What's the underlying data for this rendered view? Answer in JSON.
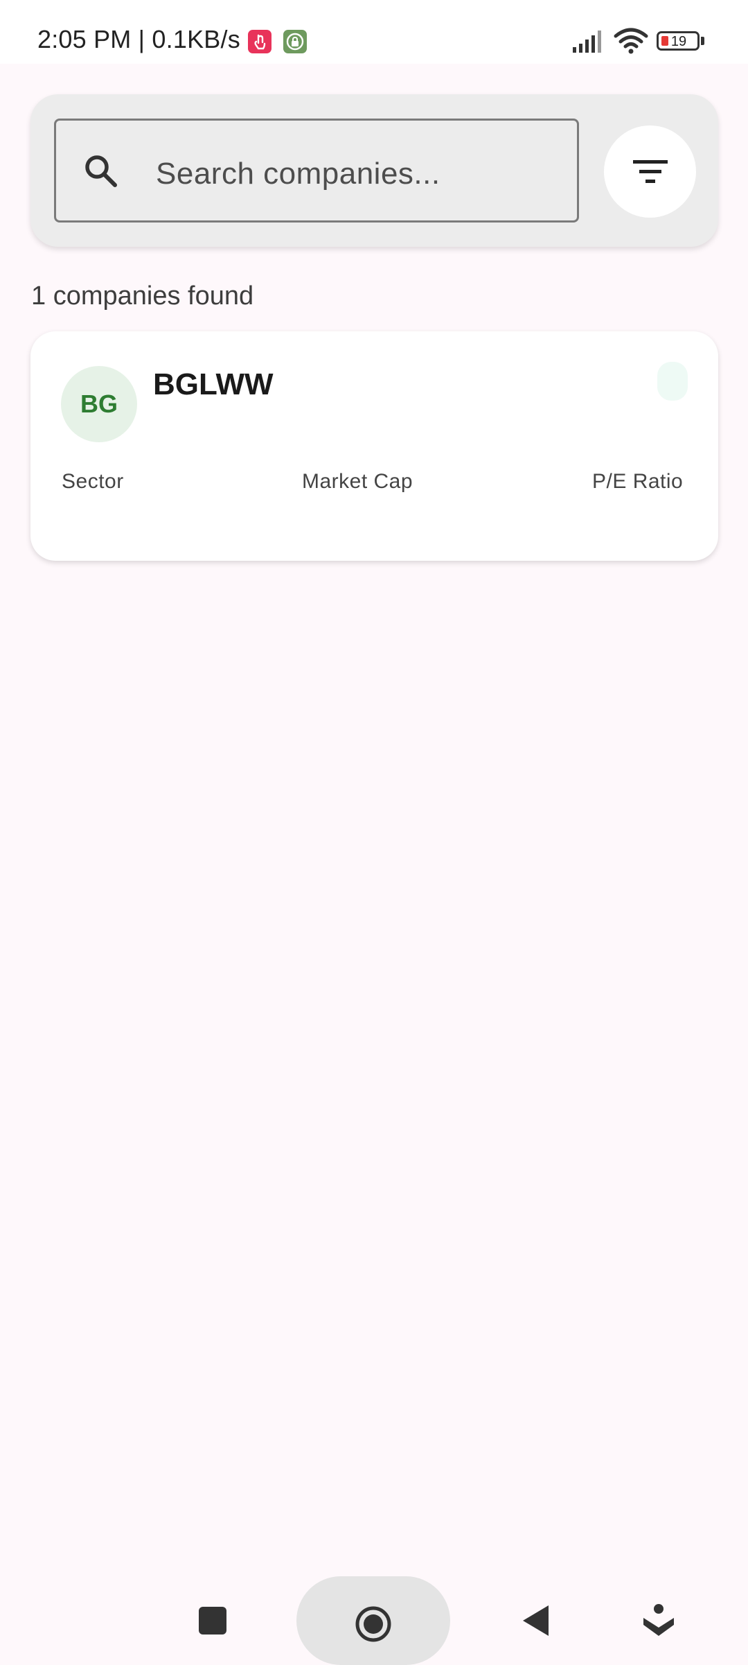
{
  "status_bar": {
    "time": "2:05 PM | 0.1KB/s",
    "battery": "19",
    "battery_color": "#e53935"
  },
  "search": {
    "placeholder": "Search companies...",
    "filter_icon": "filter-icon",
    "search_icon": "search-icon"
  },
  "results": {
    "count_text": "1 companies found"
  },
  "company_card": {
    "avatar_text": "BG",
    "avatar_color": "#2e7d32",
    "name": "BGLWW",
    "sector_label": "Sector",
    "market_cap_label": "Market Cap",
    "pe_ratio_label": "P/E Ratio"
  },
  "nav": {
    "recent_icon": "square-icon",
    "home_icon": "home-circle-icon",
    "back_icon": "back-triangle-icon",
    "extra_icon": "assistant-icon"
  }
}
